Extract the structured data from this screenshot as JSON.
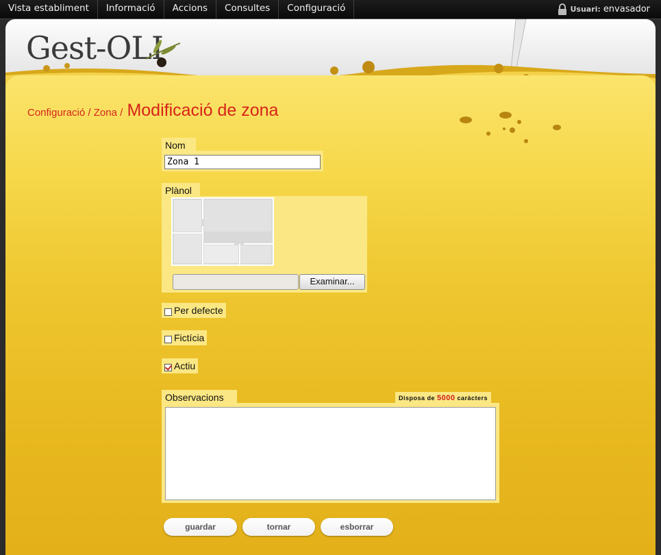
{
  "topnav": {
    "items": [
      "Vista establiment",
      "Informació",
      "Accions",
      "Consultes",
      "Configuració"
    ],
    "user_label": "Usuari:",
    "user_name": "envasador"
  },
  "header": {
    "logo_text": "Gest-OLI"
  },
  "breadcrumb": {
    "part1": "Configuració",
    "sep1": " / ",
    "part2": "Zona",
    "sep2": " / ",
    "title": "Modificació de zona"
  },
  "form": {
    "nom_label": "Nom",
    "nom_value": "Zona 1",
    "planol_label": "Plànol",
    "browse_label": "Examinar...",
    "per_defecte_label": "Per defecte",
    "ficticia_label": "Fictícia",
    "actiu_label": "Actiu",
    "observacions_label": "Observacions",
    "chars_prefix": "Disposa de",
    "chars_count": "5000",
    "chars_suffix": "caràcters",
    "observacions_value": ""
  },
  "checkboxes": {
    "per_defecte": false,
    "ficticia": false,
    "actiu": true
  },
  "buttons": {
    "guardar": "guardar",
    "tornar": "tornar",
    "esborrar": "esborrar"
  },
  "colors": {
    "accent_red": "#d6231a",
    "field_bg": "#fbe783",
    "nav_bg": "#111111"
  }
}
